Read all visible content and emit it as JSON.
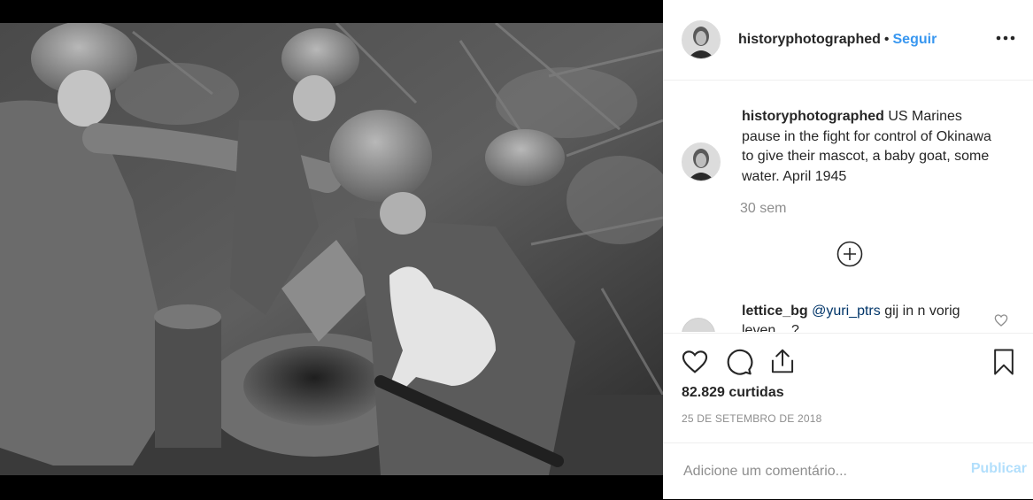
{
  "post": {
    "username": "historyphotographed",
    "separator": "•",
    "follow_label": "Seguir",
    "more_icon": "more-horizontal-icon"
  },
  "caption": {
    "username": "historyphotographed",
    "text": "US Marines pause in the fight for control of Okinawa to give their mascot, a baby goat, some water. April 1945",
    "time": "30 sem"
  },
  "load_more_icon": "plus-circle-icon",
  "comment": {
    "username": "lettice_bg",
    "mention": "@yuri_ptrs",
    "text": "gij in n vorig leven ...?"
  },
  "actions": {
    "like_icon": "heart-icon",
    "comment_icon": "comment-icon",
    "share_icon": "share-icon",
    "save_icon": "bookmark-icon"
  },
  "likes": "82.829 curtidas",
  "date": "25 DE SETEMBRO DE 2018",
  "add_comment": {
    "placeholder": "Adicione um comentário...",
    "publish_label": "Publicar"
  },
  "colors": {
    "accent": "#3897f0",
    "publish_disabled": "#b2dffc",
    "muted": "#8e8e8e",
    "text": "#262626"
  }
}
